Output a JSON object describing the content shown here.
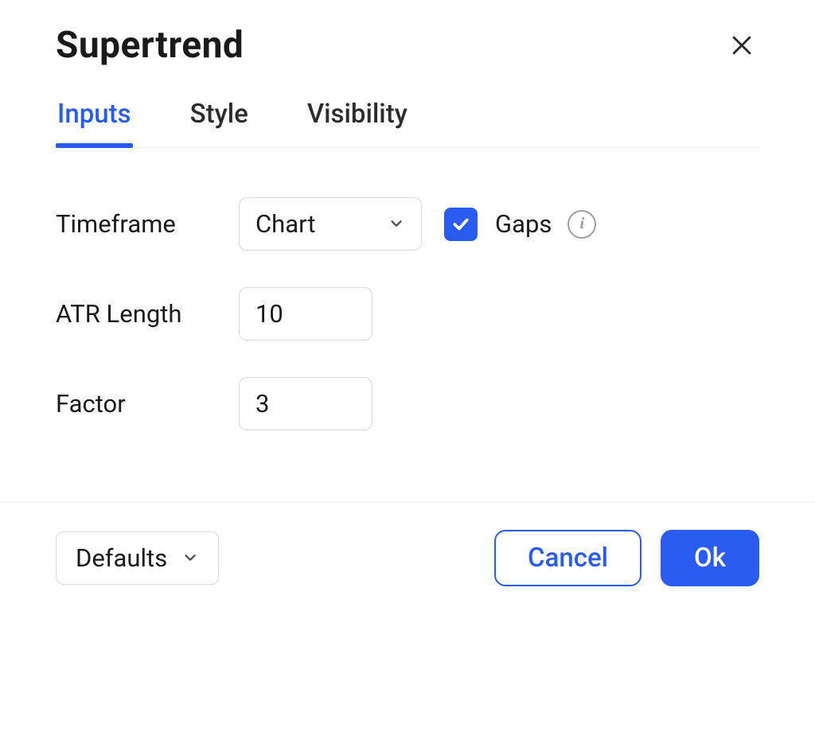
{
  "header": {
    "title": "Supertrend"
  },
  "tabs": {
    "inputs": "Inputs",
    "style": "Style",
    "visibility": "Visibility",
    "active": "inputs"
  },
  "form": {
    "timeframe": {
      "label": "Timeframe",
      "value": "Chart"
    },
    "gaps": {
      "label": "Gaps",
      "checked": true
    },
    "atr_length": {
      "label": "ATR Length",
      "value": "10"
    },
    "factor": {
      "label": "Factor",
      "value": "3"
    }
  },
  "footer": {
    "defaults": "Defaults",
    "cancel": "Cancel",
    "ok": "Ok"
  },
  "colors": {
    "accent": "#2a5bef"
  }
}
